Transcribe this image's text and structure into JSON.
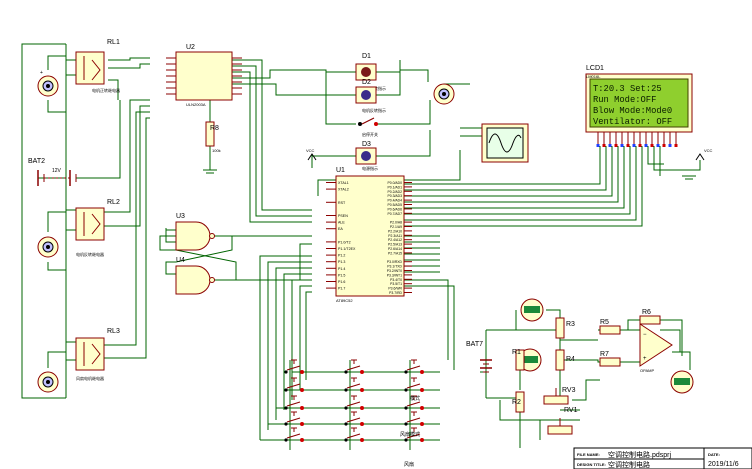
{
  "relays": [
    {
      "ref": "RL1",
      "label": "RL1",
      "coil_text": "电机正转继电器"
    },
    {
      "ref": "RL2",
      "label": "RL2",
      "coil_text": "电机反转继电器"
    },
    {
      "ref": "RL3",
      "label": "RL3",
      "coil_text": "风扇电机继电器"
    }
  ],
  "battery2": {
    "label": "BAT2",
    "value": "12V"
  },
  "u2": {
    "label": "U2",
    "part": "ULN2003A"
  },
  "r8": {
    "label": "R8",
    "value": "100k"
  },
  "diodes": [
    {
      "label": "D1",
      "text": "电机正转指示"
    },
    {
      "label": "D2",
      "text": "电机反转指示"
    },
    {
      "label": "D3",
      "text": "电源指示"
    }
  ],
  "switch_text": "启停开关",
  "u1": {
    "label": "U1",
    "part": "AT89C52",
    "left_pins": [
      "XTAL1",
      "XTAL2",
      "",
      "RST",
      "",
      "PSEN",
      "ALE",
      "EA",
      "",
      "P1.0/T2",
      "P1.1/T2EX",
      "P1.2",
      "P1.3",
      "P1.4",
      "P1.5",
      "P1.6",
      "P1.7"
    ],
    "right_pins": [
      "P0.0/AD0",
      "P0.1/AD1",
      "P0.2/AD2",
      "P0.3/AD3",
      "P0.4/AD4",
      "P0.5/AD5",
      "P0.6/AD6",
      "P0.7/AD7",
      "",
      "P2.0/A8",
      "P2.1/A9",
      "P2.2/A10",
      "P2.3/A11",
      "P2.4/A12",
      "P2.5/A13",
      "P2.6/A14",
      "P2.7/A15",
      "",
      "P3.0/RXD",
      "P3.1/TXD",
      "P3.2/INT0",
      "P3.3/INT1",
      "P3.4/T0",
      "P3.5/T1",
      "P3.6/WR",
      "P3.7/RD"
    ]
  },
  "u3": {
    "label": "U3"
  },
  "u4": {
    "label": "U4"
  },
  "lcd": {
    "label": "LCD1",
    "part": "LM016L",
    "lines": [
      "T:20.3  Set:25",
      "Run  Mode:OFF",
      "Blow Mode:Mode0",
      "Ventilator: OFF"
    ]
  },
  "analog": {
    "bat7": "BAT7",
    "r1": "R1",
    "r2": "R2",
    "r3": "R3",
    "r4": "R4",
    "r5": "R5",
    "r6": "R6",
    "r7": "R7",
    "rv1": "RV1",
    "rv3": "RV3",
    "opamp_part": "OPAMP"
  },
  "keys": {
    "mode_label": "模式",
    "fan_label": "风扇模式",
    "set_label": "风扇"
  },
  "power": {
    "vcc": "VCC"
  },
  "titleblock": {
    "file_name_label": "FILE NAME:",
    "file_name": "空调控制电路.pdsprj",
    "design_label": "DESIGN TITLE:",
    "design_value": "空调控制电路",
    "date_label": "DATE:",
    "date": "2019/11/6"
  },
  "colors": {
    "wire": "#006400",
    "component": "#8B0000",
    "fill": "#ffffcc",
    "lcd_bg": "#8fcf2e",
    "pin_blue": "#2040ff",
    "pin_red": "#d00000"
  }
}
